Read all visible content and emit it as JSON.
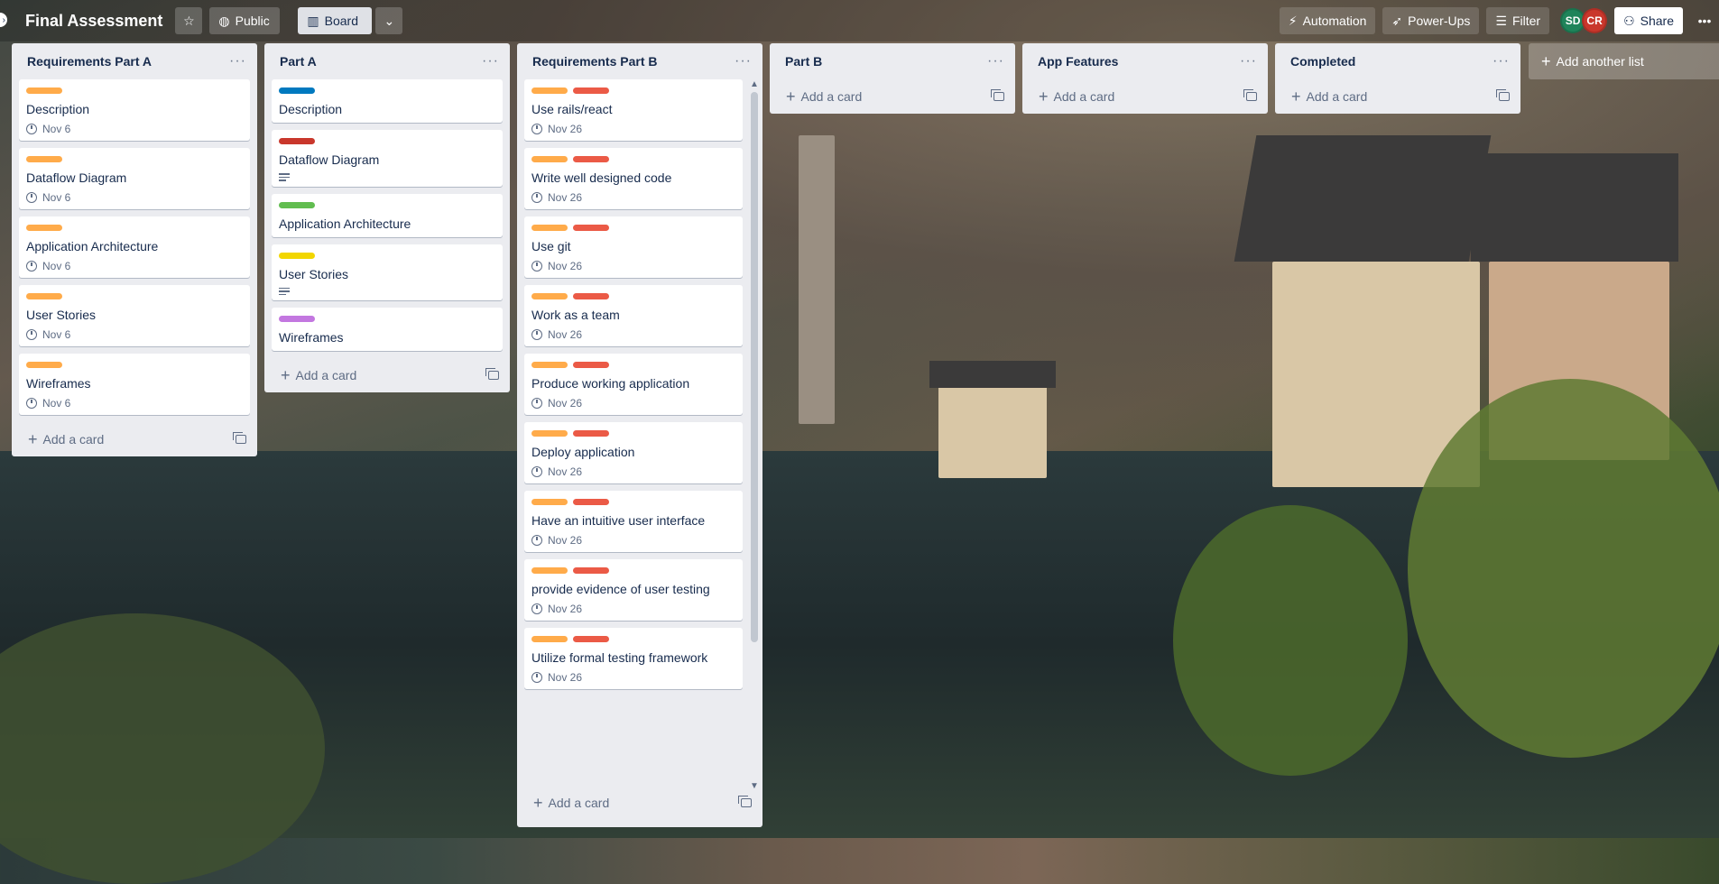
{
  "header": {
    "board_title": "Final Assessment",
    "visibility_label": "Public",
    "view_label": "Board",
    "automation_label": "Automation",
    "powerups_label": "Power-Ups",
    "filter_label": "Filter",
    "share_label": "Share",
    "members": [
      {
        "initials": "SD",
        "color": "#1f845a"
      },
      {
        "initials": "CR",
        "color": "#c9372c"
      }
    ]
  },
  "label_colors": {
    "orange": "#ffab4a",
    "red": "#eb5a46",
    "blue": "#0079bf",
    "dark_red": "#c9372c",
    "green": "#61bd4f",
    "yellow": "#f2d600",
    "purple": "#c377e0"
  },
  "lists": [
    {
      "title": "Requirements Part A",
      "add_card_label": "Add a card",
      "cards": [
        {
          "title": "Description",
          "labels": [
            "orange"
          ],
          "due": "Nov 6"
        },
        {
          "title": "Dataflow Diagram",
          "labels": [
            "orange"
          ],
          "due": "Nov 6"
        },
        {
          "title": "Application Architecture",
          "labels": [
            "orange"
          ],
          "due": "Nov 6"
        },
        {
          "title": "User Stories",
          "labels": [
            "orange"
          ],
          "due": "Nov 6"
        },
        {
          "title": "Wireframes",
          "labels": [
            "orange"
          ],
          "due": "Nov 6"
        }
      ]
    },
    {
      "title": "Part A",
      "add_card_label": "Add a card",
      "cards": [
        {
          "title": "Description",
          "labels": [
            "blue"
          ]
        },
        {
          "title": "Dataflow Diagram",
          "labels": [
            "dark_red"
          ],
          "has_description": true
        },
        {
          "title": "Application Architecture",
          "labels": [
            "green"
          ]
        },
        {
          "title": "User Stories",
          "labels": [
            "yellow"
          ],
          "has_description": true
        },
        {
          "title": "Wireframes",
          "labels": [
            "purple"
          ]
        }
      ]
    },
    {
      "title": "Requirements Part B",
      "add_card_label": "Add a card",
      "cards": [
        {
          "title": "Use rails/react",
          "labels": [
            "orange",
            "red"
          ],
          "due": "Nov 26"
        },
        {
          "title": "Write well designed code",
          "labels": [
            "orange",
            "red"
          ],
          "due": "Nov 26"
        },
        {
          "title": "Use git",
          "labels": [
            "orange",
            "red"
          ],
          "due": "Nov 26"
        },
        {
          "title": "Work as a team",
          "labels": [
            "orange",
            "red"
          ],
          "due": "Nov 26"
        },
        {
          "title": "Produce working application",
          "labels": [
            "orange",
            "red"
          ],
          "due": "Nov 26"
        },
        {
          "title": "Deploy application",
          "labels": [
            "orange",
            "red"
          ],
          "due": "Nov 26"
        },
        {
          "title": "Have an intuitive user interface",
          "labels": [
            "orange",
            "red"
          ],
          "due": "Nov 26"
        },
        {
          "title": "provide evidence of user testing",
          "labels": [
            "orange",
            "red"
          ],
          "due": "Nov 26"
        },
        {
          "title": "Utilize formal testing framework",
          "labels": [
            "orange",
            "red"
          ],
          "due": "Nov 26"
        }
      ]
    },
    {
      "title": "Part B",
      "add_card_label": "Add a card",
      "cards": []
    },
    {
      "title": "App Features",
      "add_card_label": "Add a card",
      "cards": []
    },
    {
      "title": "Completed",
      "add_card_label": "Add a card",
      "cards": []
    }
  ],
  "add_list_label": "Add another list"
}
